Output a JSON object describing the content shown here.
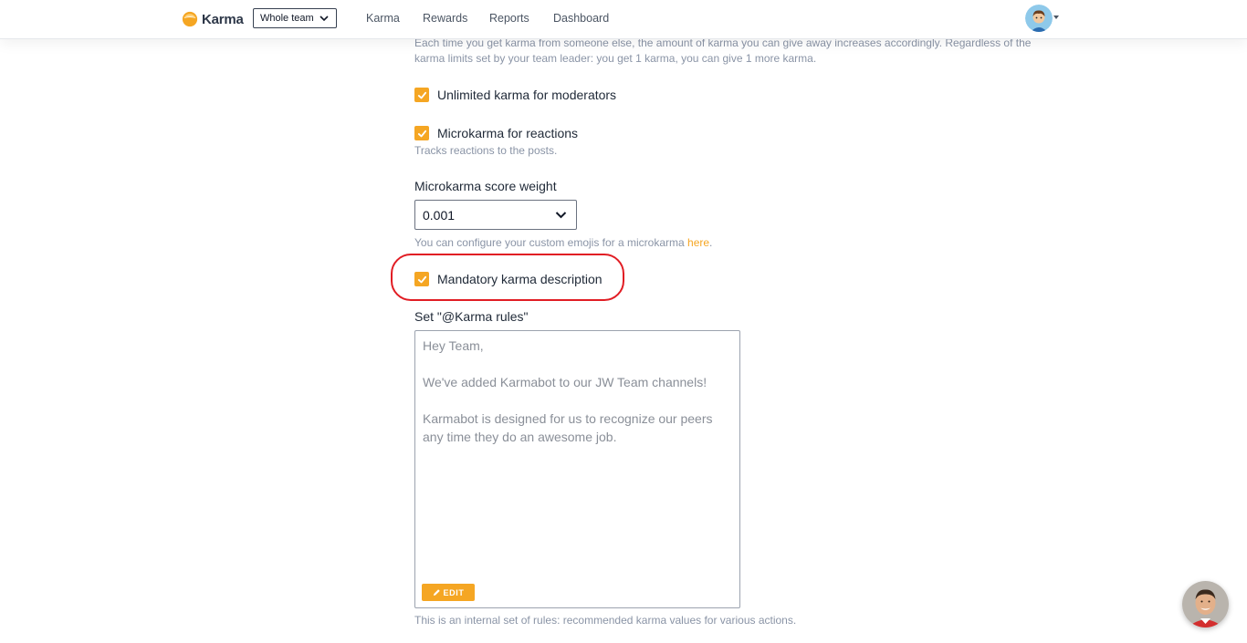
{
  "header": {
    "logo_text": "Karma",
    "team_selector": {
      "selected": "Whole team"
    },
    "nav": [
      "Karma",
      "Rewards",
      "Reports",
      "Dashboard"
    ],
    "accent": "#f5a623"
  },
  "settings": {
    "intro_line1": "Each time you get karma from someone else, the amount of karma you can give away increases accordingly. Regardless of the",
    "intro_line2": "karma limits set by your team leader: you get 1 karma, you can give 1 more karma.",
    "unlimited_karma": {
      "label": "Unlimited karma for moderators",
      "checked": true
    },
    "microkarma_reactions": {
      "label": "Microkarma for reactions",
      "checked": true,
      "hint": "Tracks reactions to the posts."
    },
    "score_weight": {
      "label": "Microkarma score weight",
      "value": "0.001",
      "hint_prefix": "You can configure your custom emojis for a microkarma ",
      "hint_link": "here",
      "hint_suffix": "."
    },
    "mandatory_description": {
      "label": "Mandatory karma description",
      "checked": true
    },
    "rules": {
      "label": "Set \"@Karma rules\"",
      "text": "Hey Team,\n\nWe've added Karmabot to our JW Team channels!\n\nKarmabot is designed for us to recognize our peers\nany time they do an awesome job.",
      "edit_label": "EDIT",
      "hint": "This is an internal set of rules: recommended karma values for various actions."
    }
  },
  "icons": [
    "karma-logo-icon",
    "chevron-down-icon",
    "check-icon",
    "pencil-icon",
    "user-avatar",
    "support-chat-avatar"
  ]
}
